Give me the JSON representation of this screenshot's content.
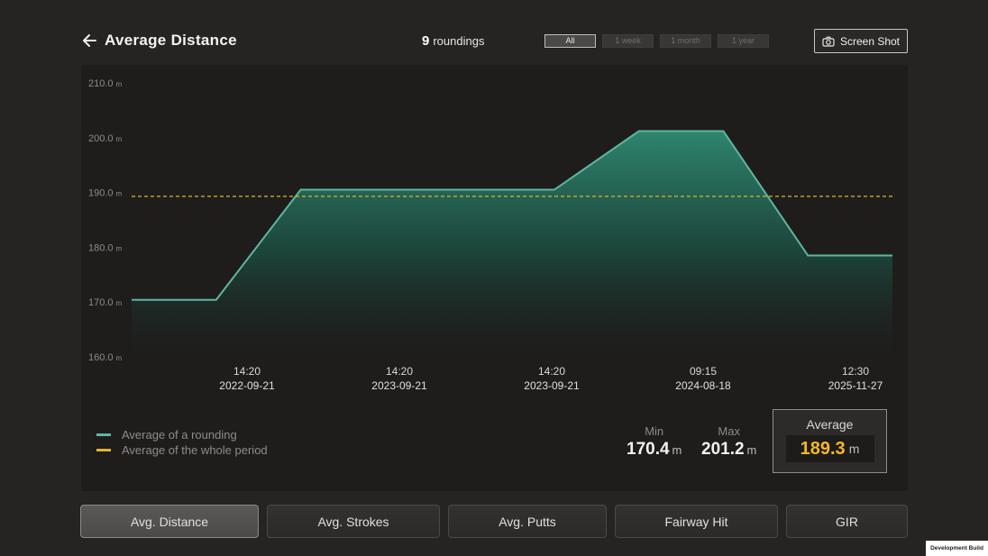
{
  "header": {
    "title": "Average Distance",
    "round_count": "9",
    "round_count_label": "roundings",
    "ranges": [
      {
        "label": "All",
        "active": true
      },
      {
        "label": "1 week",
        "active": false
      },
      {
        "label": "1 month",
        "active": false
      },
      {
        "label": "1 year",
        "active": false
      }
    ],
    "screenshot_label": "Screen Shot"
  },
  "chart_data": {
    "type": "area",
    "y_unit": "m",
    "ylim": [
      160,
      210
    ],
    "y_ticks": [
      "210.0",
      "200.0",
      "190.0",
      "180.0",
      "170.0",
      "160.0"
    ],
    "x_ticks": [
      {
        "time": "14:20",
        "date": "2022-09-21"
      },
      {
        "time": "14:20",
        "date": "2023-09-21"
      },
      {
        "time": "14:20",
        "date": "2023-09-21"
      },
      {
        "time": "09:15",
        "date": "2024-08-18"
      },
      {
        "time": "12:30",
        "date": "2025-11-27"
      }
    ],
    "series": [
      {
        "name": "Average of a rounding",
        "color": "#5fb6a0",
        "values": [
          170.4,
          170.4,
          190.5,
          190.5,
          190.5,
          190.5,
          201.2,
          201.2,
          178.5,
          178.5
        ]
      }
    ],
    "reference_line": {
      "name": "Average of the whole period",
      "value": 189.3,
      "color": "#e0b52a"
    },
    "grid": false
  },
  "legend": {
    "items": [
      {
        "label": "Average of a rounding",
        "color": "#5fb6a0"
      },
      {
        "label": "Average of the whole period",
        "color": "#e0b52a"
      }
    ]
  },
  "stats": {
    "min_label": "Min",
    "min_value": "170.4",
    "min_unit": "m",
    "max_label": "Max",
    "max_value": "201.2",
    "max_unit": "m",
    "avg_label": "Average",
    "avg_value": "189.3",
    "avg_unit": "m"
  },
  "tabs": [
    {
      "label": "Avg. Distance",
      "active": true
    },
    {
      "label": "Avg. Strokes",
      "active": false
    },
    {
      "label": "Avg. Putts",
      "active": false
    },
    {
      "label": "Fairway Hit",
      "active": false
    },
    {
      "label": "GIR",
      "active": false
    }
  ],
  "footer": {
    "dev_build": "Development Build"
  }
}
